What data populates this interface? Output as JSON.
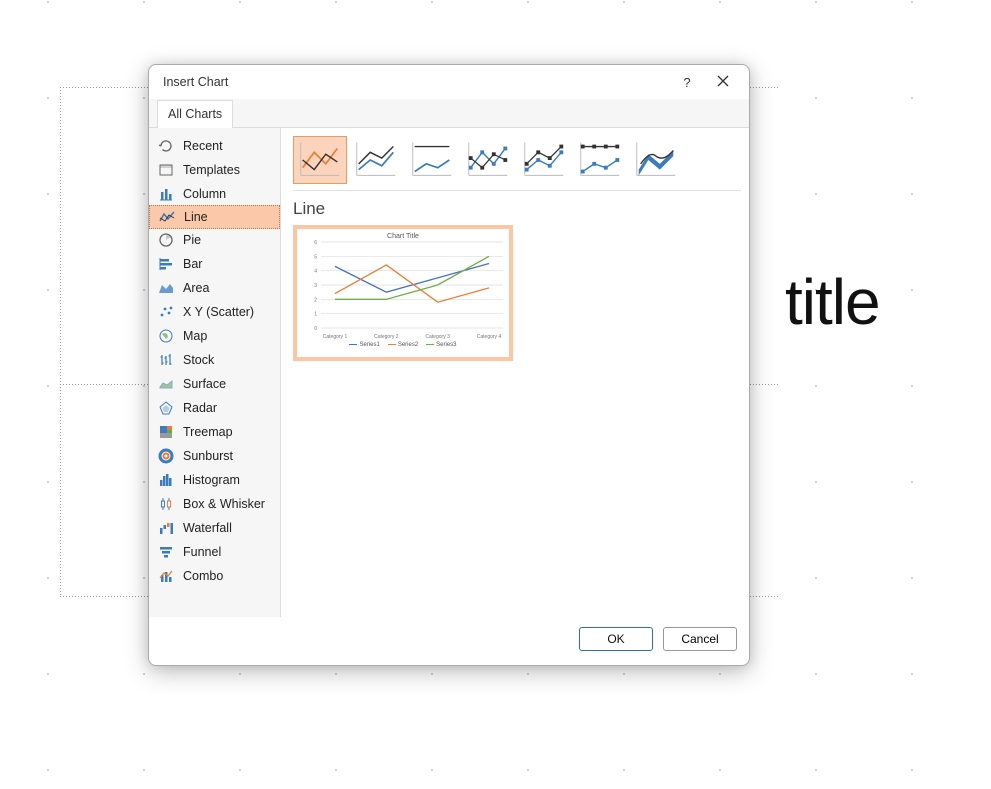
{
  "background": {
    "placeholder_text": "title"
  },
  "dialog": {
    "title": "Insert Chart",
    "help_tooltip": "?",
    "tab_label": "All Charts",
    "sidebar": [
      {
        "label": "Recent",
        "icon": "recent-icon",
        "selected": false
      },
      {
        "label": "Templates",
        "icon": "templates-icon",
        "selected": false
      },
      {
        "label": "Column",
        "icon": "column-icon",
        "selected": false
      },
      {
        "label": "Line",
        "icon": "line-icon",
        "selected": true
      },
      {
        "label": "Pie",
        "icon": "pie-icon",
        "selected": false
      },
      {
        "label": "Bar",
        "icon": "bar-icon",
        "selected": false
      },
      {
        "label": "Area",
        "icon": "area-icon",
        "selected": false
      },
      {
        "label": "X Y (Scatter)",
        "icon": "scatter-icon",
        "selected": false
      },
      {
        "label": "Map",
        "icon": "map-icon",
        "selected": false
      },
      {
        "label": "Stock",
        "icon": "stock-icon",
        "selected": false
      },
      {
        "label": "Surface",
        "icon": "surface-icon",
        "selected": false
      },
      {
        "label": "Radar",
        "icon": "radar-icon",
        "selected": false
      },
      {
        "label": "Treemap",
        "icon": "treemap-icon",
        "selected": false
      },
      {
        "label": "Sunburst",
        "icon": "sunburst-icon",
        "selected": false
      },
      {
        "label": "Histogram",
        "icon": "histogram-icon",
        "selected": false
      },
      {
        "label": "Box & Whisker",
        "icon": "boxwhisker-icon",
        "selected": false
      },
      {
        "label": "Waterfall",
        "icon": "waterfall-icon",
        "selected": false
      },
      {
        "label": "Funnel",
        "icon": "funnel-icon",
        "selected": false
      },
      {
        "label": "Combo",
        "icon": "combo-icon",
        "selected": false
      }
    ],
    "subtypes": [
      {
        "name": "line",
        "selected": true
      },
      {
        "name": "stacked-line",
        "selected": false
      },
      {
        "name": "stacked-line-100",
        "selected": false
      },
      {
        "name": "line-with-markers",
        "selected": false
      },
      {
        "name": "stacked-line-with-markers",
        "selected": false
      },
      {
        "name": "stacked-line-100-with-markers",
        "selected": false
      },
      {
        "name": "3d-line",
        "selected": false
      }
    ],
    "subtype_title": "Line",
    "preview": {
      "title": "Chart Title",
      "categories": [
        "Category 1",
        "Category 2",
        "Category 3",
        "Category 4"
      ],
      "legend": [
        "Series1",
        "Series2",
        "Series3"
      ]
    },
    "footer": {
      "ok": "OK",
      "cancel": "Cancel"
    }
  },
  "chart_data": {
    "type": "line",
    "title": "Chart Title",
    "xlabel": "",
    "ylabel": "",
    "ylim": [
      0,
      6
    ],
    "yticks": [
      0,
      1,
      2,
      3,
      4,
      5,
      6
    ],
    "categories": [
      "Category 1",
      "Category 2",
      "Category 3",
      "Category 4"
    ],
    "series": [
      {
        "name": "Series1",
        "values": [
          4.3,
          2.5,
          3.5,
          4.5
        ],
        "color": "#4472c4"
      },
      {
        "name": "Series2",
        "values": [
          2.4,
          4.4,
          1.8,
          2.8
        ],
        "color": "#ed7d31"
      },
      {
        "name": "Series3",
        "values": [
          2.0,
          2.0,
          3.0,
          5.0
        ],
        "color": "#70ad47"
      }
    ]
  }
}
